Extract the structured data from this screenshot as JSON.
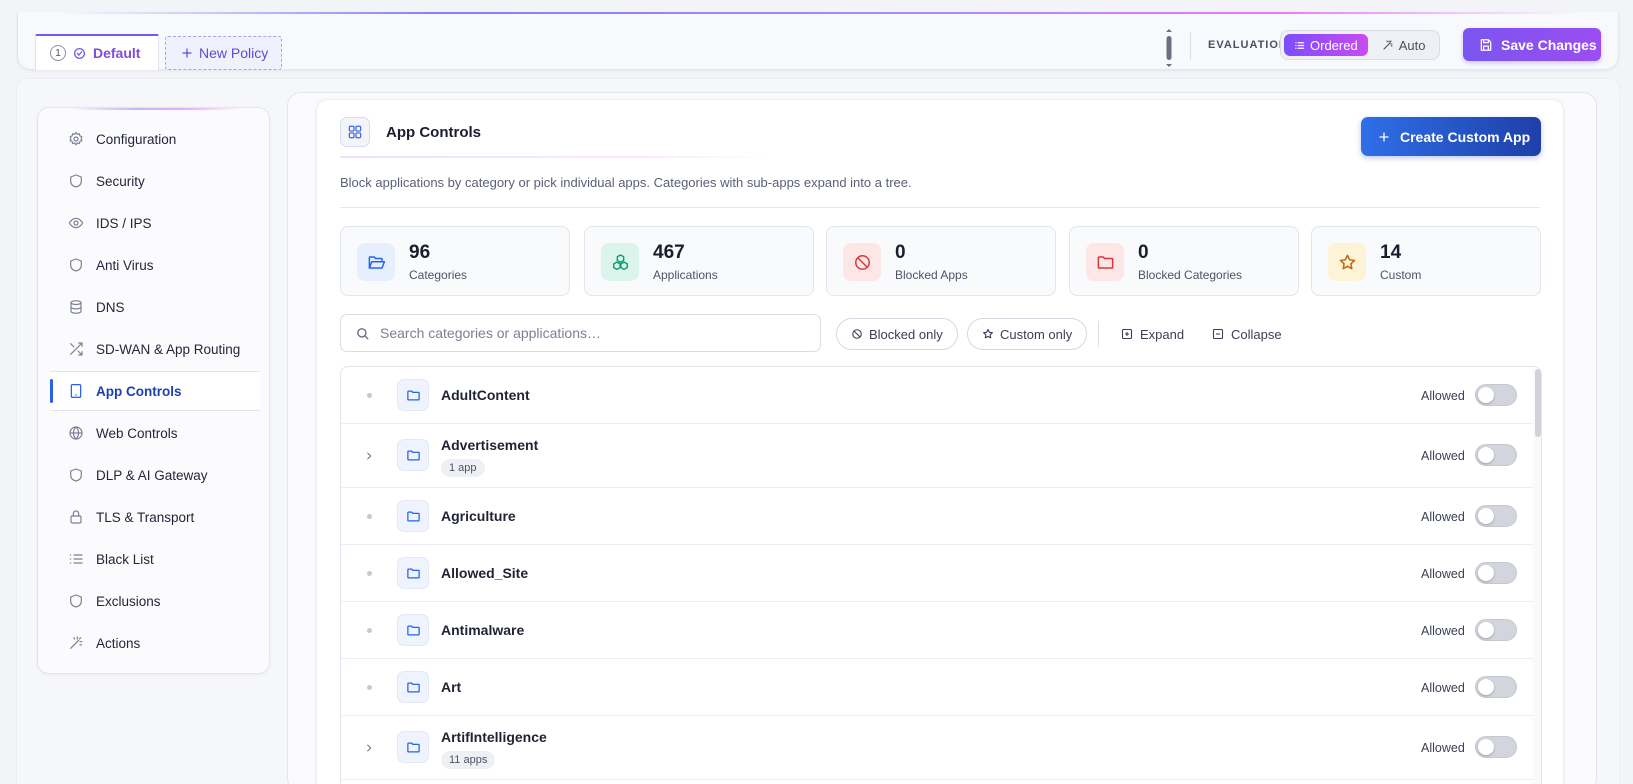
{
  "topbar": {
    "tabs": [
      {
        "number": "1",
        "label": "Default"
      }
    ],
    "new_policy_label": "New Policy",
    "evaluation_label": "EVALUATION",
    "evaluation_options": [
      {
        "label": "Ordered",
        "active": true
      },
      {
        "label": "Auto",
        "active": false
      }
    ],
    "save_label": "Save Changes"
  },
  "sidebar": {
    "items": [
      {
        "label": "Configuration",
        "icon": "gear-icon"
      },
      {
        "label": "Security",
        "icon": "shield-icon"
      },
      {
        "label": "IDS / IPS",
        "icon": "eye-icon"
      },
      {
        "label": "Anti Virus",
        "icon": "shield-icon"
      },
      {
        "label": "DNS",
        "icon": "database-icon"
      },
      {
        "label": "SD-WAN & App Routing",
        "icon": "shuffle-icon"
      },
      {
        "label": "App Controls",
        "icon": "tablet-icon",
        "active": true
      },
      {
        "label": "Web Controls",
        "icon": "globe-icon"
      },
      {
        "label": "DLP & AI Gateway",
        "icon": "shield-icon"
      },
      {
        "label": "TLS & Transport",
        "icon": "lock-icon"
      },
      {
        "label": "Black List",
        "icon": "list-icon"
      },
      {
        "label": "Exclusions",
        "icon": "shield-icon"
      },
      {
        "label": "Actions",
        "icon": "wand-icon"
      }
    ]
  },
  "main": {
    "title": "App Controls",
    "description": "Block applications by category or pick individual apps. Categories with sub-apps expand into a tree.",
    "create_label": "Create Custom App",
    "stats": [
      {
        "value": "96",
        "label": "Categories",
        "icon": "folder-open-icon",
        "color": "#2563eb",
        "bg": "#e7efff"
      },
      {
        "value": "467",
        "label": "Applications",
        "icon": "boxes-icon",
        "color": "#0f9d6b",
        "bg": "#dcf5ec"
      },
      {
        "value": "0",
        "label": "Blocked Apps",
        "icon": "ban-icon",
        "color": "#d9383b",
        "bg": "#fde6e6"
      },
      {
        "value": "0",
        "label": "Blocked Categories",
        "icon": "folder-icon",
        "color": "#d9383b",
        "bg": "#fde6e6"
      },
      {
        "value": "14",
        "label": "Custom",
        "icon": "star-icon",
        "color": "#c98a0a",
        "bg": "#fdf3d6"
      }
    ],
    "search_placeholder": "Search categories or applications…",
    "filters": {
      "blocked_only": "Blocked only",
      "custom_only": "Custom only",
      "expand": "Expand",
      "collapse": "Collapse"
    },
    "rows": [
      {
        "name": "AdultContent",
        "expandable": false,
        "status": "Allowed"
      },
      {
        "name": "Advertisement",
        "expandable": true,
        "badge": "1 app",
        "status": "Allowed"
      },
      {
        "name": "Agriculture",
        "expandable": false,
        "status": "Allowed"
      },
      {
        "name": "Allowed_Site",
        "expandable": false,
        "status": "Allowed"
      },
      {
        "name": "Antimalware",
        "expandable": false,
        "status": "Allowed"
      },
      {
        "name": "Art",
        "expandable": false,
        "status": "Allowed"
      },
      {
        "name": "ArtifIntelligence",
        "expandable": true,
        "badge": "11 apps",
        "status": "Allowed"
      }
    ]
  }
}
